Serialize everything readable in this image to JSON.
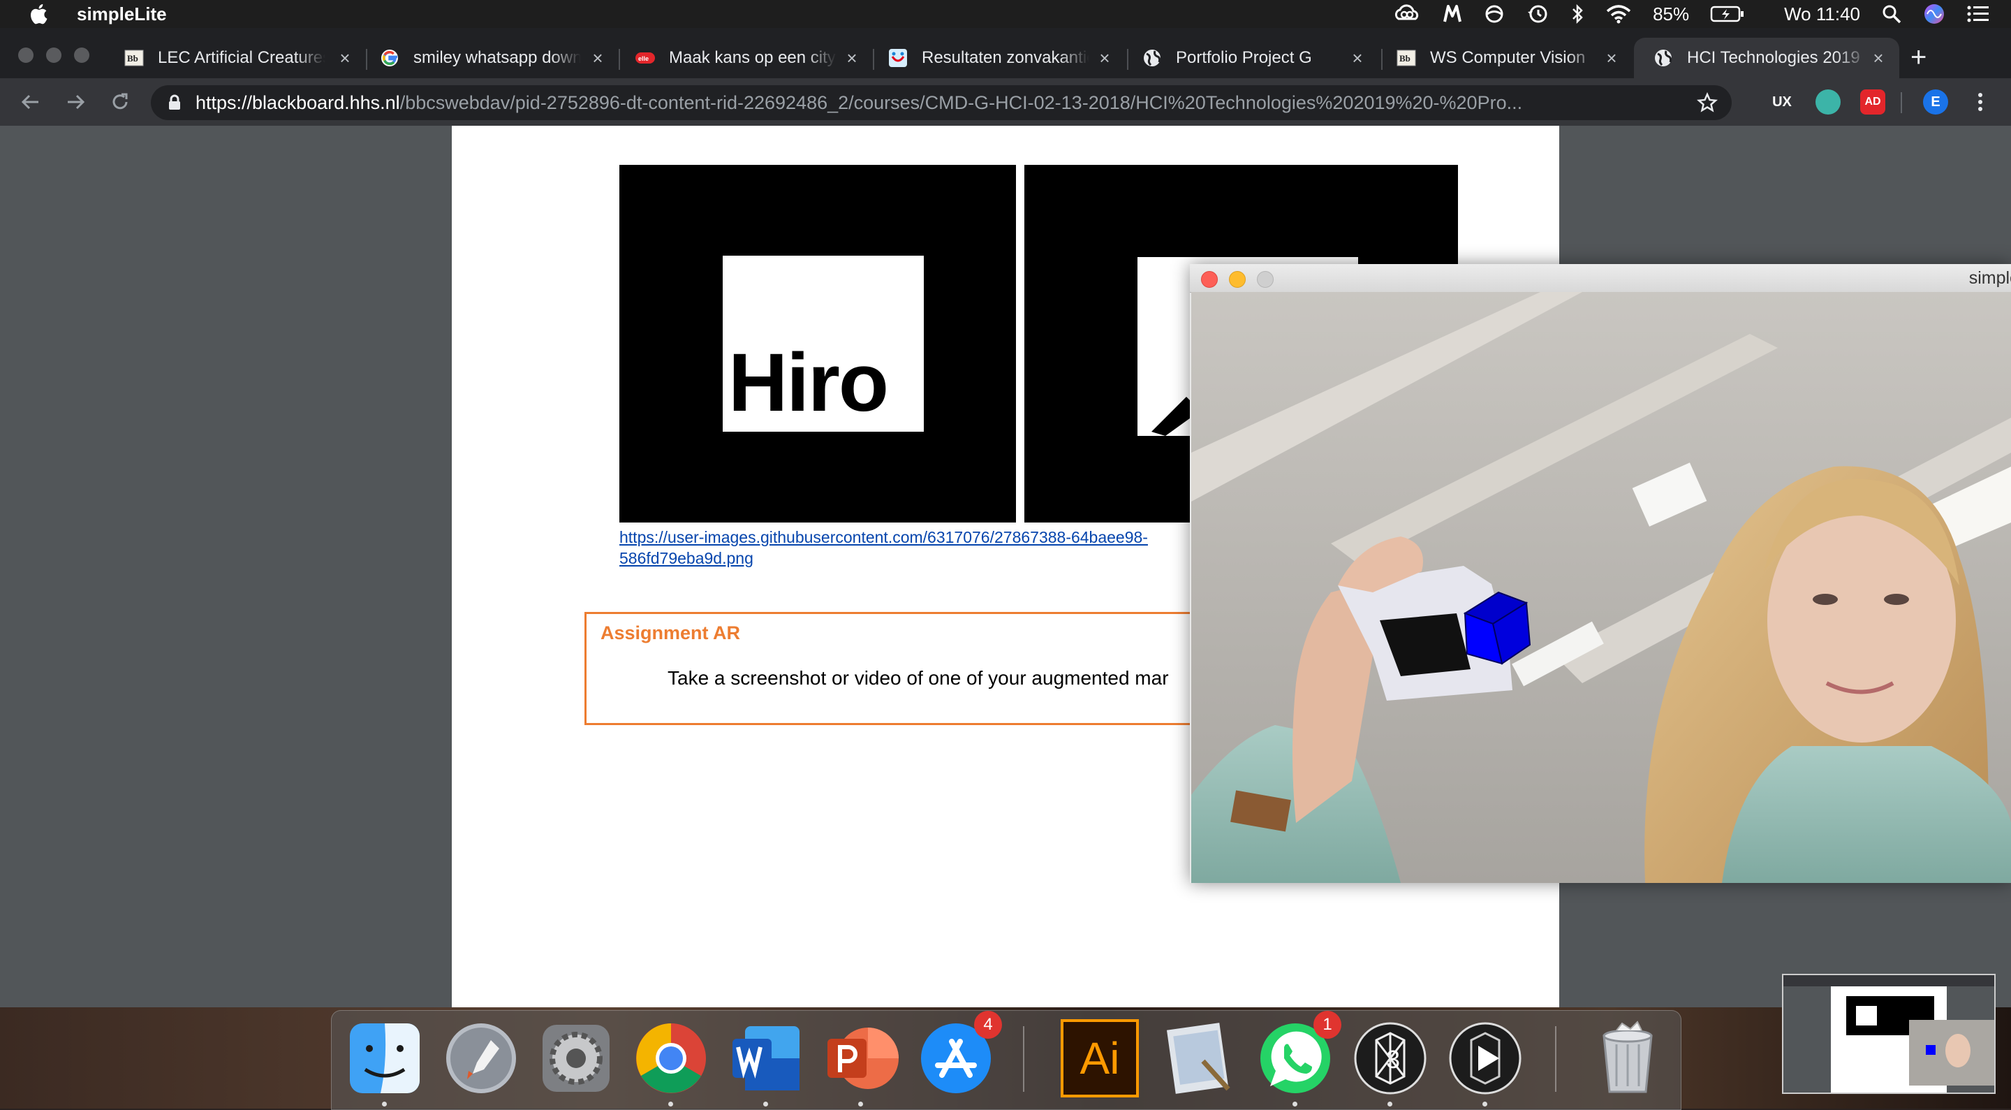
{
  "menubar": {
    "app_name": "simpleLite",
    "battery": "85%",
    "clock": "Wo 11:40",
    "icons": [
      "apple-icon",
      "creative-cloud-icon",
      "m-app-icon",
      "circle-app-icon",
      "time-machine-icon",
      "bluetooth-icon",
      "wifi-icon",
      "battery-icon",
      "search-icon",
      "siri-icon",
      "notification-center-icon"
    ]
  },
  "tabs": [
    {
      "title": "LEC Artificial Creatures",
      "favicon": "blackboard-icon"
    },
    {
      "title": "smiley whatsapp download",
      "favicon": "google-icon"
    },
    {
      "title": "Maak kans op een citytrip",
      "favicon": "red-logo-icon"
    },
    {
      "title": "Resultaten zonvakanties",
      "favicon": "tui-icon"
    },
    {
      "title": "Portfolio Project G",
      "favicon": "globe-icon"
    },
    {
      "title": "WS Computer Vision",
      "favicon": "blackboard-icon"
    },
    {
      "title": "HCI Technologies 2019",
      "favicon": "globe-icon"
    }
  ],
  "toolbar": {
    "url_host": "https://blackboard.hhs.nl",
    "url_path": "/bbcswebdav/pid-2752896-dt-content-rid-22692486_2/courses/CMD-G-HCI-02-13-2018/HCI%20Technologies%202019%20-%20Pro...",
    "extensions": [
      "UX",
      "",
      "AD"
    ],
    "profile_initial": "E"
  },
  "document": {
    "marker_text": "Hiro",
    "link_line1": "https://user-images.githubusercontent.com/6317076/27867388-64baee98-",
    "link_line2": "586fd79eba9d.png",
    "assignment_title": "Assignment AR",
    "assignment_body": "Take a screenshot or video of one of your augmented mar"
  },
  "simplelite": {
    "title": "simpleLite",
    "cube_color": "#0000ff"
  },
  "dock": {
    "apps": [
      "finder",
      "launchpad",
      "system-preferences",
      "chrome",
      "word",
      "powerpoint",
      "app-store",
      "illustrator",
      "preview",
      "whatsapp",
      "processing",
      "quicktime",
      "trash"
    ],
    "app_store_badge": "4",
    "whatsapp_badge": "1",
    "illustrator_label": "Ai"
  }
}
